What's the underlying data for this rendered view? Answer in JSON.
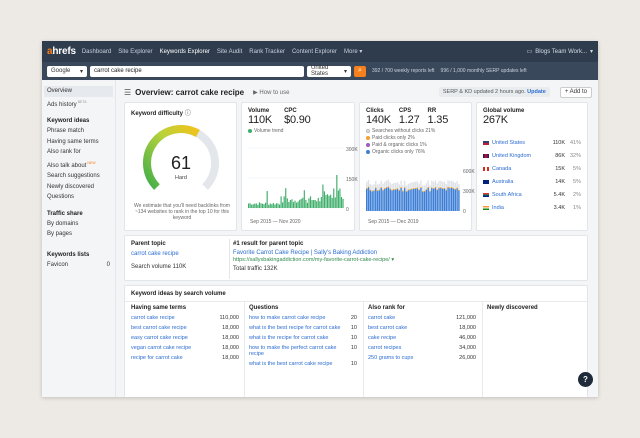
{
  "topnav": {
    "logo_a": "a",
    "logo_rest": "hrefs",
    "items": [
      "Dashboard",
      "Site Explorer",
      "Keywords Explorer",
      "Site Audit",
      "Rank Tracker",
      "Content Explorer",
      "More"
    ],
    "account": "Blogs Team Work..."
  },
  "search": {
    "engine": "Google",
    "keyword": "carrot cake recipe",
    "country": "United States",
    "reports_left": "392 / 700 weekly reports left",
    "serp_updates_left": "996 / 1,000 monthly SERP updates left"
  },
  "sidebar": {
    "overview": "Overview",
    "ads_history": "Ads history",
    "ads_badge": "BETA",
    "keyword_ideas_title": "Keyword ideas",
    "keyword_ideas": [
      "Phrase match",
      "Having same terms",
      "Also rank for",
      "Also talk about",
      "Search suggestions",
      "Newly discovered",
      "Questions"
    ],
    "new_badge": "NEW",
    "traffic_share_title": "Traffic share",
    "traffic_share": [
      "By domains",
      "By pages"
    ],
    "keywords_lists_title": "Keywords lists",
    "favicon": "Favicon",
    "favicon_count": "0"
  },
  "header": {
    "title": "Overview: carrot cake recipe",
    "how_to_use": "How to use",
    "serp_text": "SERP & KD updated 2 hours ago.",
    "update": "Update",
    "add_to": "+ Add to"
  },
  "kd": {
    "title": "Keyword difficulty",
    "value": "61",
    "level": "Hard",
    "gauge_fraction": 0.61,
    "note": "We estimate that you'll need backlinks from ~134 websites to rank in the top 10 for this keyword"
  },
  "volume": {
    "label": "Volume",
    "value": "110K",
    "cpc_label": "CPC",
    "cpc_value": "$0.90",
    "trend_label": "Volume trend",
    "ymax": "300K",
    "ymid": "150K",
    "ymin": "0",
    "x_range": "Sep 2015 — Nov 2020",
    "bar_color": "#3fae6a"
  },
  "clicks": {
    "label": "Clicks",
    "value": "140K",
    "cps_label": "CPS",
    "cps_value": "1.27",
    "rr_label": "RR",
    "rr_value": "1.35",
    "legend": [
      "Searches without clicks 21%",
      "Paid clicks only 2%",
      "Paid & organic clicks 1%",
      "Organic clicks only 76%"
    ],
    "legend_colors": [
      "#dfe3e8",
      "#f4a02a",
      "#9a5cbf",
      "#3d7fd6"
    ],
    "ymax": "600K",
    "ymid": "300K",
    "ymin": "0",
    "x_range": "Sep 2015 — Dec 2019"
  },
  "global": {
    "title": "Global volume",
    "value": "267K",
    "countries": [
      {
        "name": "United States",
        "vol": "110K",
        "pct": "41%"
      },
      {
        "name": "United Kingdom",
        "vol": "86K",
        "pct": "32%"
      },
      {
        "name": "Canada",
        "vol": "15K",
        "pct": "5%"
      },
      {
        "name": "Australia",
        "vol": "14K",
        "pct": "5%"
      },
      {
        "name": "South Africa",
        "vol": "5.4K",
        "pct": "2%"
      },
      {
        "name": "India",
        "vol": "3.4K",
        "pct": "1%"
      }
    ]
  },
  "parent": {
    "title": "Parent topic",
    "topic": "carrot cake recipe",
    "search_volume": "Search volume 110K",
    "result_title": "#1 result for parent topic",
    "result_name": "Favorite Carrot Cake Recipe | Sally's Baking Addiction",
    "result_url": "https://sallysbakingaddiction.com/my-favorite-carrot-cake-recipe/ ▾",
    "total_traffic": "Total traffic 132K"
  },
  "ideas": {
    "title": "Keyword ideas by search volume",
    "col1": {
      "title": "Having same terms",
      "rows": [
        {
          "k": "carrot cake recipe",
          "v": "110,000"
        },
        {
          "k": "best carrot cake recipe",
          "v": "18,000"
        },
        {
          "k": "easy carrot cake recipe",
          "v": "18,000"
        },
        {
          "k": "vegan carrot cake recipe",
          "v": "18,000"
        },
        {
          "k": "recipe for carrot cake",
          "v": "18,000"
        }
      ]
    },
    "col2": {
      "title": "Questions",
      "rows": [
        {
          "k": "how to make carrot cake recipe",
          "v": "20"
        },
        {
          "k": "what is the best recipe for carrot cake",
          "v": "10"
        },
        {
          "k": "what is the recipe for carrot cake",
          "v": "10"
        },
        {
          "k": "how to make the perfect carrot cake recipe",
          "v": "10"
        },
        {
          "k": "what is the best carrot cake recipe",
          "v": "10"
        }
      ]
    },
    "col3": {
      "title": "Also rank for",
      "rows": [
        {
          "k": "carrot cake",
          "v": "121,000"
        },
        {
          "k": "best carrot cake",
          "v": "18,000"
        },
        {
          "k": "cake recipe",
          "v": "46,000"
        },
        {
          "k": "carrot recipes",
          "v": "34,000"
        },
        {
          "k": "250 grams to cups",
          "v": "26,000"
        }
      ]
    },
    "col4": {
      "title": "Newly discovered"
    }
  },
  "help": "?"
}
